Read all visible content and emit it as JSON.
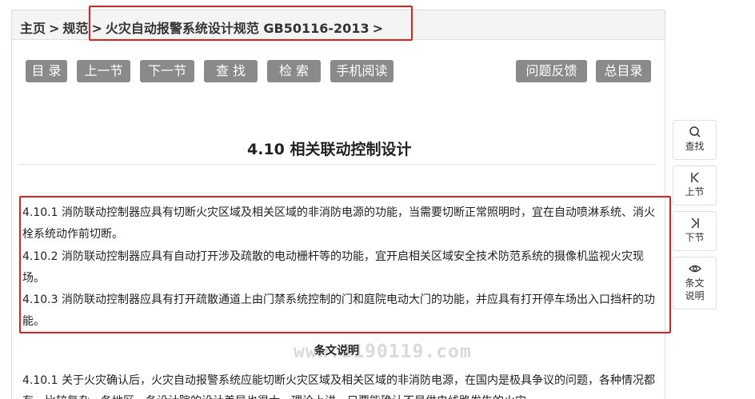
{
  "breadcrumb": {
    "home": "主页",
    "spec": "规范",
    "current": "火灾自动报警系统设计规范 GB50116-2013",
    "separator": ">"
  },
  "toolbar": {
    "catalog": "目 录",
    "prev": "上一节",
    "next": "下一节",
    "find": "查 找",
    "search": "检 索",
    "mobile": "手机阅读",
    "feedback": "问题反馈",
    "total_catalog": "总目录"
  },
  "section": {
    "title": "4.10  相关联动控制设计"
  },
  "clauses": [
    "4.10.1 消防联动控制器应具有切断火灾区域及相关区域的非消防电源的功能，当需要切断正常照明时，宜在自动喷淋系统、消火栓系统动作前切断。",
    "4.10.2 消防联动控制器应具有自动打开涉及疏散的电动栅杆等的功能，宜开启相关区域安全技术防范系统的摄像机监视火灾现场。",
    "4.10.3 消防联动控制器应具有打开疏散通道上由门禁系统控制的门和庭院电动大门的功能，并应具有打开停车场出入口挡杆的功能。"
  ],
  "explanation": {
    "heading": "条文说明",
    "watermark": "www.1190119.com",
    "text": "4.10.1 关于火灾确认后，火灾自动报警系统应能切断火灾区域及相关区域的非消防电源，在国内是极具争议的问题，各种情况都有，比较复杂，各地区、各设计院的设计差异也很大，理论上讲，只要能确认不是供电线路发生的火灾"
  },
  "side_tools": [
    {
      "label": "查找",
      "icon": "search-icon"
    },
    {
      "label": "上节",
      "icon": "prev-section-icon"
    },
    {
      "label": "下节",
      "icon": "next-section-icon"
    },
    {
      "label": "条文说明",
      "icon": "eye-icon"
    }
  ],
  "colors": {
    "button_bg": "#8a8a8a",
    "highlight_red": "#e0201e",
    "crumb_bg": "#f4f4f4"
  }
}
